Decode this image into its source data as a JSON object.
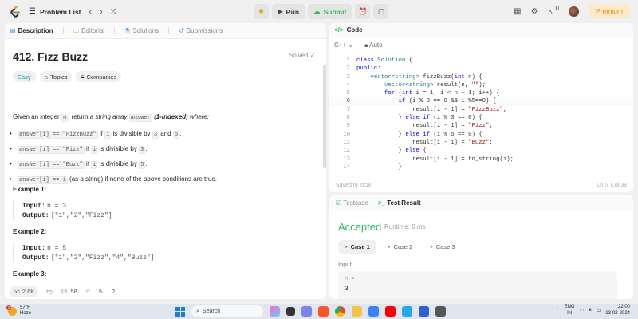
{
  "topbar": {
    "problem_list": "Problem List",
    "run": "Run",
    "submit": "Submit",
    "streak": "0",
    "premium": "Premium"
  },
  "left": {
    "tabs": [
      "Description",
      "Editorial",
      "Solutions",
      "Submissions"
    ],
    "title": "412. Fizz Buzz",
    "solved": "Solved",
    "badges": [
      "Easy",
      "Topics",
      "Companies"
    ],
    "intro_1": "Given an integer ",
    "intro_n": "n",
    "intro_2": ", return ",
    "intro_3": "a string array ",
    "intro_answer": "answer",
    "intro_4": " (",
    "intro_5": "1-indexed",
    "intro_6": ") where:",
    "bullets": [
      {
        "code": "answer[i] == \"FizzBuzz\"",
        "t1": " if ",
        "c2": "i",
        "t2": " is divisible by ",
        "c3": "3",
        "t3": " and ",
        "c4": "5",
        "t4": "."
      },
      {
        "code": "answer[i] == \"Fizz\"",
        "t1": " if ",
        "c2": "i",
        "t2": " is divisible by ",
        "c3": "3",
        "t3": ".",
        "c4": "",
        "t4": ""
      },
      {
        "code": "answer[i] == \"Buzz\"",
        "t1": " if ",
        "c2": "i",
        "t2": " is divisible by ",
        "c3": "5",
        "t3": ".",
        "c4": "",
        "t4": ""
      },
      {
        "code": "answer[i] == i",
        "t1": " (as a string) if none of the above conditions are true.",
        "c2": "",
        "t2": "",
        "c3": "",
        "t3": "",
        "c4": "",
        "t4": ""
      }
    ],
    "examples": [
      {
        "header": "Example 1:",
        "input_label": "Input:",
        "input": "n = 3",
        "output_label": "Output:",
        "output": "[\"1\",\"2\",\"Fizz\"]"
      },
      {
        "header": "Example 2:",
        "input_label": "Input:",
        "input": "n = 5",
        "output_label": "Output:",
        "output": "[\"1\",\"2\",\"Fizz\",\"4\",\"Buzz\"]"
      },
      {
        "header": "Example 3:"
      }
    ],
    "likes": "2.6K",
    "comments": "58"
  },
  "code": {
    "header": "Code",
    "language": "C++",
    "auto": "Auto",
    "lines": [
      {
        "n": "1",
        "html": "<span class='kw'>class</span> <span class='ty'>Solution</span> {"
      },
      {
        "n": "2",
        "html": "<span class='kw'>public</span>:"
      },
      {
        "n": "3",
        "html": "    <span class='ty'>vector</span>&lt;<span class='ty'>string</span>&gt; fizzBuzz(<span class='kw'>int</span> n) {"
      },
      {
        "n": "4",
        "html": "        <span class='ty'>vector</span>&lt;<span class='ty'>string</span>&gt; result(n, <span class='st'>\"\"</span>);"
      },
      {
        "n": "5",
        "html": "        <span class='kw'>for</span> (<span class='kw'>int</span> i = 1; i &lt; n + 1; i++) {"
      },
      {
        "n": "6",
        "html": "            <span class='kw'>if</span> (i % 3 == 0 &amp;&amp; i %5==0) {"
      },
      {
        "n": "7",
        "html": "                result[i - 1] = <span class='st'>\"FizzBuzz\"</span>;"
      },
      {
        "n": "8",
        "html": "            } <span class='kw'>else if</span> (i % 3 == 0) {"
      },
      {
        "n": "9",
        "html": "                result[i - 1] = <span class='st'>\"Fizz\"</span>;"
      },
      {
        "n": "10",
        "html": "            } <span class='kw'>else if</span> (i % 5 == 0) {"
      },
      {
        "n": "11",
        "html": "                result[i - 1] = <span class='st'>\"Buzz\"</span>;"
      },
      {
        "n": "12",
        "html": "            } <span class='kw'>else</span> {"
      },
      {
        "n": "13",
        "html": "                result[i - 1] = to_string(i);"
      },
      {
        "n": "14",
        "html": "            }"
      }
    ],
    "current_line": "6",
    "saved": "Saved to local",
    "cursor": "Ln 6, Col 38"
  },
  "result": {
    "tabs": [
      "Testcase",
      "Test Result"
    ],
    "status": "Accepted",
    "runtime": "Runtime: 0 ms",
    "cases": [
      "Case 1",
      "Case 2",
      "Case 3"
    ],
    "input_label": "Input",
    "input_key": "n =",
    "input_value": "3"
  },
  "taskbar": {
    "temp": "57°F",
    "weather": "Haze",
    "search": "Search",
    "lang1": "ENG",
    "lang2": "IN",
    "time": "22:00",
    "date": "13-02-2024",
    "badge": "1"
  },
  "colors": {
    "accent": "#2cbb5d",
    "easy": "#00af9b",
    "premium": "#e58a00"
  }
}
